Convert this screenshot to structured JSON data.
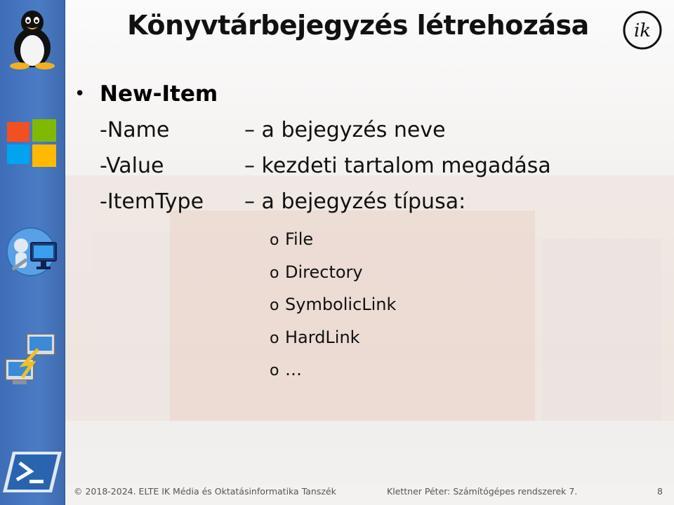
{
  "slide": {
    "title": "Könyvtárbejegyzés létrehozása",
    "logo_text": "ik",
    "bullet_marker": "•",
    "command": "New-Item",
    "parameters": [
      {
        "name": "-Name",
        "description": "– a bejegyzés neve"
      },
      {
        "name": "-Value",
        "description": "– kezdeti tartalom megadása"
      },
      {
        "name": "-ItemType",
        "description": "– a bejegyzés típusa:"
      }
    ],
    "sub_marker": "o",
    "item_types": [
      "File",
      "Directory",
      "SymbolicLink",
      "HardLink",
      "…"
    ]
  },
  "sidebar": {
    "icons": [
      "linux-penguin-icon",
      "windows-logo-icon",
      "remote-admin-icon",
      "network-computers-icon",
      "powershell-icon"
    ]
  },
  "footer": {
    "copyright": "© 2018-2024. ELTE IK Média és Oktatásinformatika Tanszék",
    "author": "Klettner Péter: Számítógépes rendszerek 7.",
    "page_number": "8"
  },
  "colors": {
    "sidebar": "#4a7cc4",
    "text": "#111111",
    "footer_text": "#555555"
  }
}
